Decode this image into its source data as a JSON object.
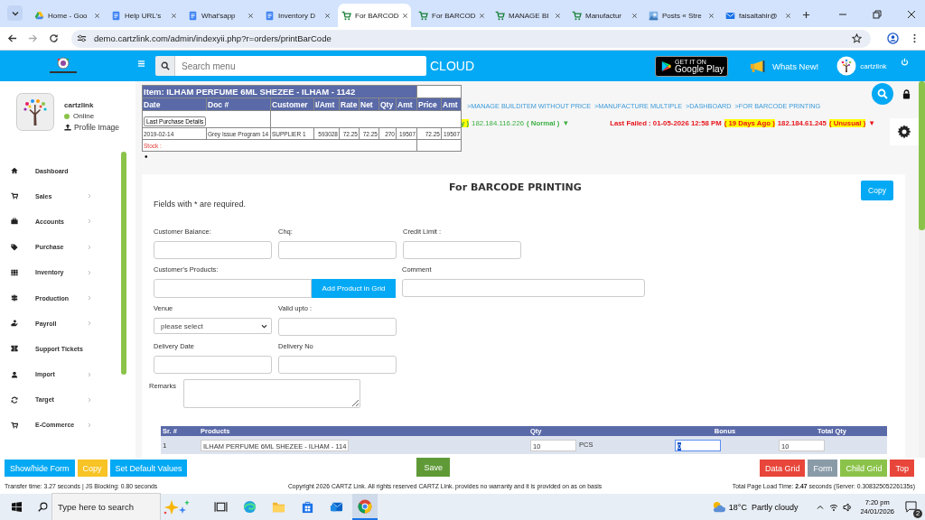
{
  "browser": {
    "tabs": [
      {
        "title": "Home - Goo",
        "kind": "drive",
        "selected": false
      },
      {
        "title": "Help URL's",
        "kind": "doc",
        "selected": false
      },
      {
        "title": "What'sapp",
        "kind": "doc",
        "selected": false
      },
      {
        "title": "Inventory D",
        "kind": "doc",
        "selected": false
      },
      {
        "title": "For BARCOD",
        "kind": "cart",
        "selected": true
      },
      {
        "title": "For BARCOD",
        "kind": "cart",
        "selected": false
      },
      {
        "title": "MANAGE BI",
        "kind": "cart",
        "selected": false
      },
      {
        "title": "Manufactur",
        "kind": "cart",
        "selected": false
      },
      {
        "title": "Posts « Stre",
        "kind": "site",
        "selected": false
      },
      {
        "title": "faisaltahir@",
        "kind": "mail",
        "selected": false
      }
    ],
    "url": "demo.cartzlink.com/admin/indexyii.php?r=orders/printBarCode"
  },
  "header": {
    "search_placeholder": "Search menu",
    "brand": "CLOUD",
    "store_badge": {
      "top": "GET IT ON",
      "bottom": "Google Play"
    },
    "whats_new": "Whats New!",
    "user": "cartzlink"
  },
  "sidebar": {
    "profile": {
      "name": "cartzlink",
      "status": "Online",
      "online": true,
      "link": "Profile Image"
    },
    "items": [
      {
        "label": "Dashboard",
        "has_children": false
      },
      {
        "label": "Sales",
        "has_children": true
      },
      {
        "label": "Accounts",
        "has_children": true
      },
      {
        "label": "Purchase",
        "has_children": true
      },
      {
        "label": "Inventory",
        "has_children": true
      },
      {
        "label": "Production",
        "has_children": true
      },
      {
        "label": "Payroll",
        "has_children": true
      },
      {
        "label": "Support Tickets",
        "has_children": false
      },
      {
        "label": "Import",
        "has_children": true
      },
      {
        "label": "Target",
        "has_children": true
      },
      {
        "label": "E-Commerce",
        "has_children": true
      }
    ]
  },
  "breadcrumbs": [
    ">MANAGE BUILDITEM WITHOUT PRICE",
    ">MANUFACTURE MULTIPLE",
    ">DASHBOARD",
    ">FOR BARCODE PRINTING"
  ],
  "login_status": [
    {
      "kind": "success",
      "segments": [
        {
          "text": "y )",
          "highlight": true
        },
        {
          "text": "182.184.116.226",
          "highlight": false
        },
        {
          "text": "( Normal )",
          "highlight": false
        },
        {
          "text": "▼",
          "highlight": false
        }
      ]
    },
    {
      "kind": "failed",
      "segments": [
        {
          "text": "Last Failed : 01-05-2026 12:58 PM",
          "highlight": false
        },
        {
          "text": "( 19 Days Ago )",
          "highlight": true
        },
        {
          "text": "182.184.61.245",
          "highlight": false
        },
        {
          "text": "( Unusual )",
          "highlight": true
        },
        {
          "text": "▼",
          "highlight": false
        }
      ]
    }
  ],
  "bullet": "•",
  "popup": {
    "title": "Item: ILHAM PERFUME 6ML SHEZEE - ILHAM - 1142",
    "columns": [
      "Date",
      "Doc #",
      "Customer",
      "I/Amt",
      "Rate",
      "Net",
      "Qty",
      "Amt",
      "Price",
      "Amt"
    ],
    "tab": "Last Purchase Details",
    "rows": [
      [
        "2019-02-14",
        "Grey Issue Program 14",
        "SUPPLIER 1",
        "593028",
        "72.25",
        "72.25",
        "270",
        "19507",
        "72.25",
        "19507"
      ]
    ],
    "stock_label": "Stock :"
  },
  "form": {
    "title": "For BARCODE PRINTING",
    "copy_button": "Copy",
    "required_note": "Fields with * are required.",
    "rows": [
      [
        {
          "kind": "text",
          "label": "Customer Balance:"
        },
        {
          "kind": "text",
          "label": "Chq:"
        },
        {
          "kind": "text",
          "label": "Credit Limit :"
        }
      ],
      [
        {
          "kind": "product_picker",
          "label": "Customer's Products:"
        },
        {
          "kind": "button",
          "label": "Add Product in Grid"
        },
        {
          "kind": "wide_text",
          "label": "Comment"
        }
      ],
      [
        {
          "kind": "select",
          "label": "Venue",
          "value": "please select"
        },
        {
          "kind": "text",
          "label": "Valid upto :"
        }
      ],
      [
        {
          "kind": "text",
          "label": "Delivery Date"
        },
        {
          "kind": "text",
          "label": "Delivery No"
        }
      ]
    ],
    "remarks_label": "Remarks"
  },
  "grid": {
    "columns": [
      {
        "label": "Sr. #",
        "kind": "sr"
      },
      {
        "label": "Products",
        "kind": "product"
      },
      {
        "label": "Qty",
        "kind": "qty"
      },
      {
        "label": "Bonus",
        "kind": "bonus"
      },
      {
        "label": "Total Qty",
        "kind": "total"
      }
    ],
    "rows": [
      {
        "sr": "1",
        "product": "ILHAM PERFUME 6ML SHEZEE - ILHAM - 114",
        "qty": "10",
        "unit": "PCS",
        "bonus": "0",
        "bonus_selected": true,
        "total": "10"
      }
    ]
  },
  "actions": {
    "left": [
      {
        "label": "Show/hide Form",
        "color": "#03a9f4"
      },
      {
        "label": "Copy",
        "color": "#f7c325"
      },
      {
        "label": "Set Default Values",
        "color": "#03a9f4"
      }
    ],
    "save": {
      "label": "Save",
      "color": "#5f9a37"
    },
    "right": [
      {
        "label": "Data Grid",
        "color": "#e8463a"
      },
      {
        "label": "Form",
        "color": "#8a9ba8"
      },
      {
        "label": "Child Grid",
        "color": "#8bc34a"
      },
      {
        "label": "Top",
        "color": "#e8463a"
      }
    ]
  },
  "footer": {
    "left": "Transfer time: 3.27 seconds | JS Blocking: 0.80 seconds",
    "center": "Copyright 2026 CARTZ Link. All rights reserved CARTZ Link. provides no warranty and it is provided on as on basis",
    "right": "Total Page Load Time: **2.47** seconds (Server: 0.30832505226135s)"
  },
  "taskbar": {
    "search_placeholder": "Type here to search",
    "temperature": "18°C",
    "weather": "Partly cloudy",
    "time": "7:20 pm",
    "date": "24/01/2026",
    "notifications": "2"
  }
}
